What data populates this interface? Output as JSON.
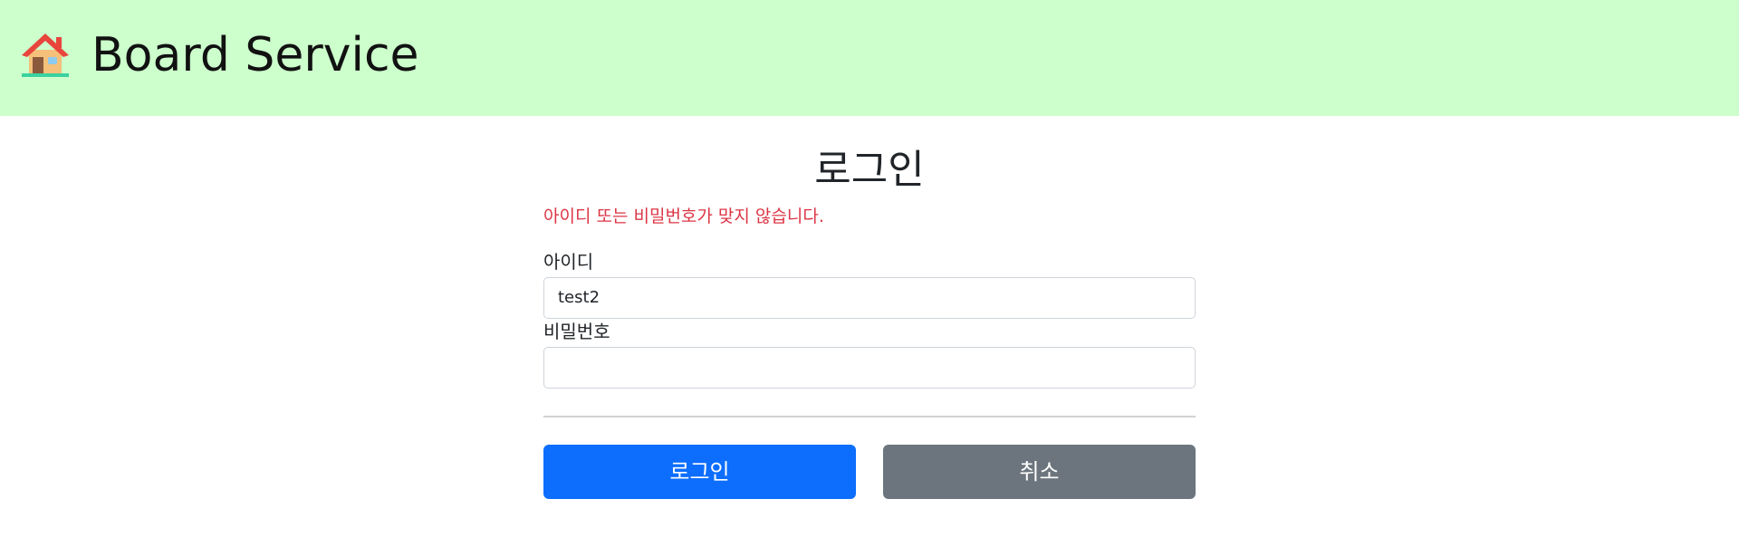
{
  "header": {
    "brand": "Board Service",
    "logo_icon": "house-icon",
    "background": "#ccffcc"
  },
  "login": {
    "title": "로그인",
    "error_message": "아이디 또는 비밀번호가 맞지 않습니다.",
    "username": {
      "label": "아이디",
      "value": "test2"
    },
    "password": {
      "label": "비밀번호",
      "value": ""
    },
    "buttons": {
      "login": "로그인",
      "cancel": "취소"
    }
  },
  "colors": {
    "error": "#dc3545",
    "primary": "#0d6efd",
    "secondary": "#6c757d"
  }
}
